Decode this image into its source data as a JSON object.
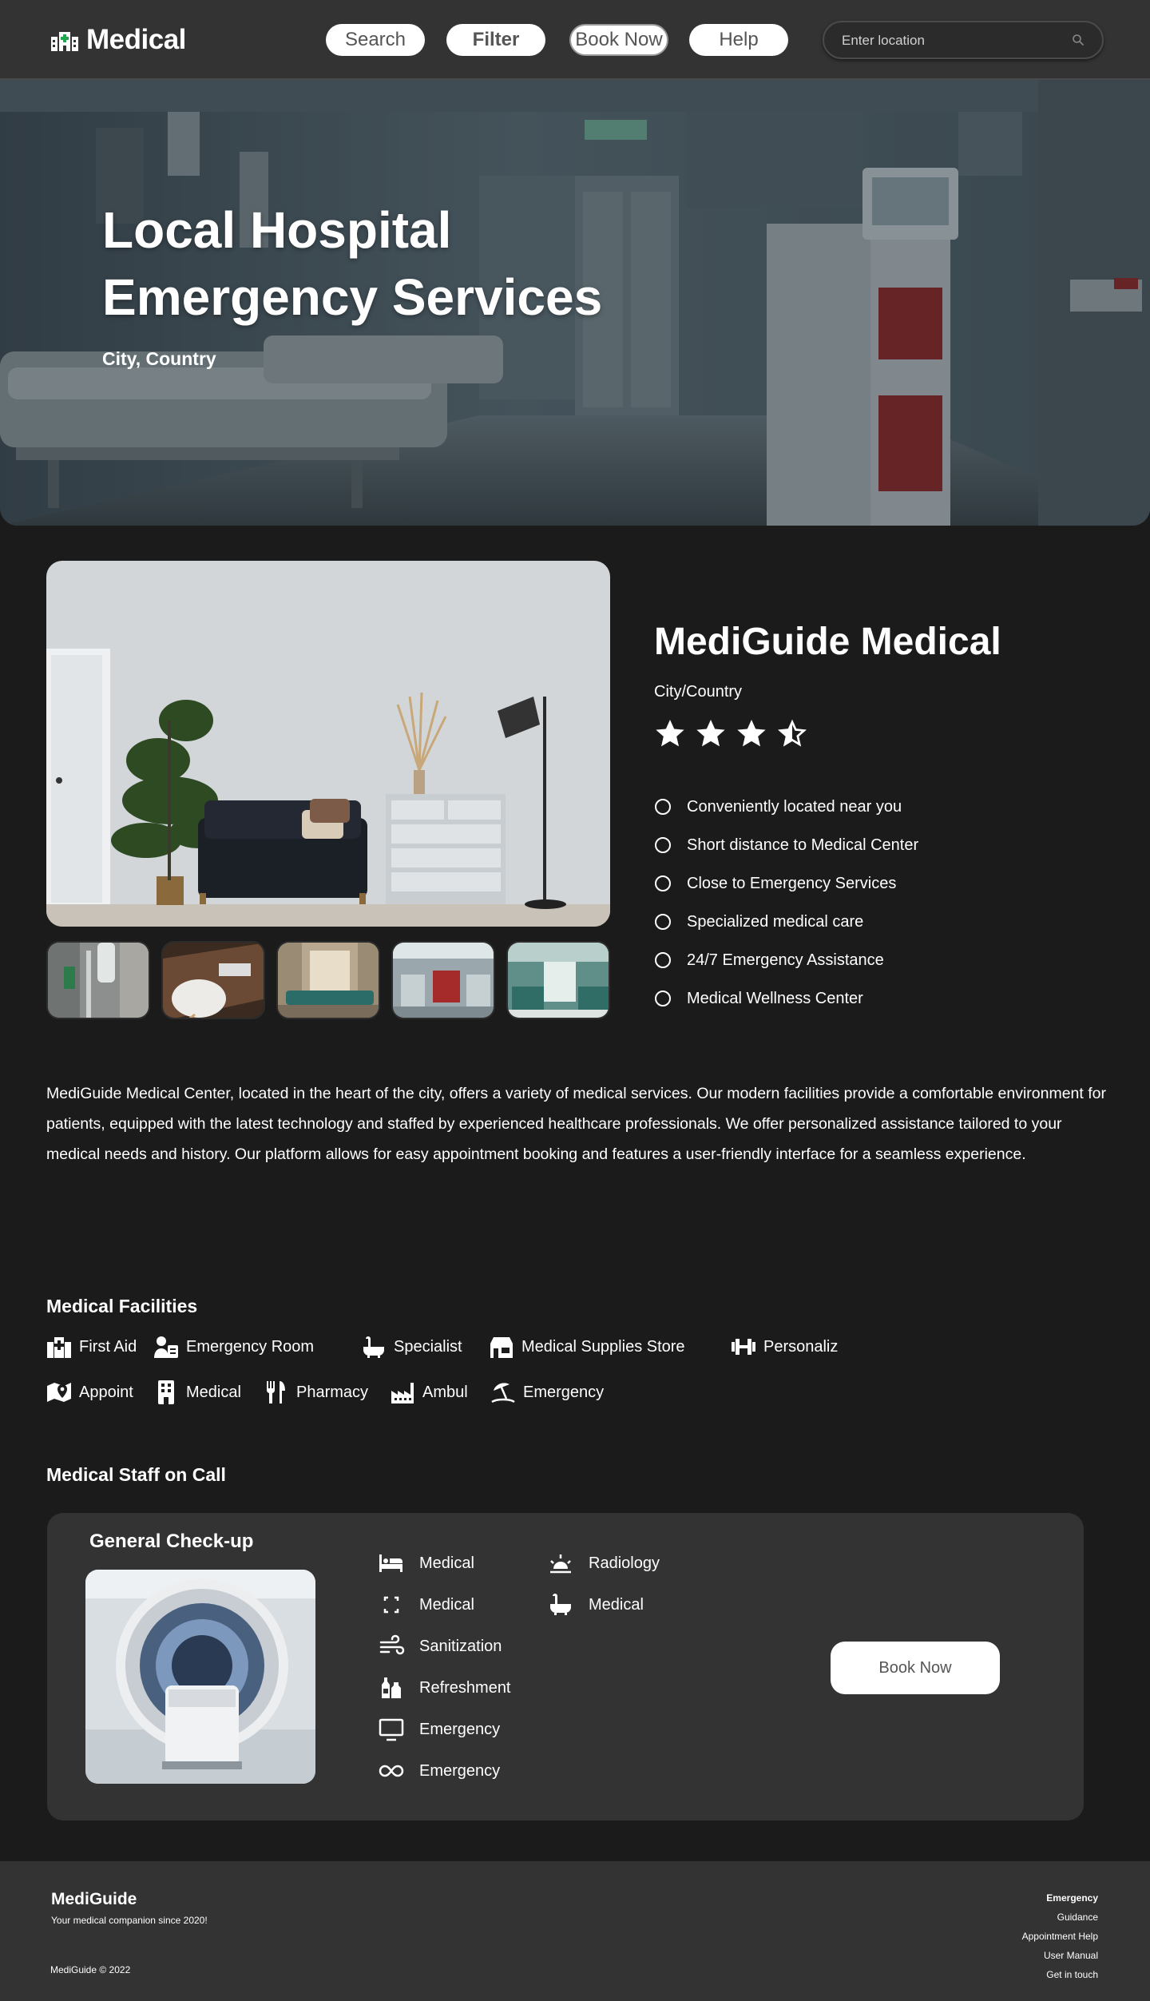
{
  "nav": {
    "brand": "Medical",
    "buttons": [
      "Search",
      "Filter",
      "Book Now",
      "Help"
    ],
    "location_placeholder": "Enter location"
  },
  "hero": {
    "title": "Local Hospital Emergency Services",
    "subtitle": "City, Country"
  },
  "clinic": {
    "name": "MediGuide Medical",
    "location": "City/Country",
    "rating": 3.5,
    "rating_max": 4,
    "features": [
      "Conveniently located near you",
      "Short distance to Medical Center",
      "Close to Emergency Services",
      "Specialized medical care",
      "24/7 Emergency Assistance",
      "Medical Wellness Center"
    ],
    "description": "MediGuide Medical Center, located in the heart of the city, offers a variety of medical services. Our modern facilities provide a comfortable environment for patients, equipped with the latest technology and staffed by experienced healthcare professionals. We offer personalized assistance tailored to your medical needs and history. Our platform allows for easy appointment booking and features a user-friendly interface for a seamless experience."
  },
  "facilities": {
    "title": "Medical Facilities",
    "items": [
      {
        "label": "First Aid",
        "icon": "hospital-building-icon"
      },
      {
        "label": "Emergency Room",
        "icon": "doctor-id-icon"
      },
      {
        "label": "Specialist",
        "icon": "bathtub-icon"
      },
      {
        "label": "Medical Supplies Store",
        "icon": "shop-icon"
      },
      {
        "label": "Personaliz",
        "icon": "dumbbell-icon"
      },
      {
        "label": "Appoint",
        "icon": "map-pin-icon"
      },
      {
        "label": "Medical",
        "icon": "building-icon"
      },
      {
        "label": "Pharmacy",
        "icon": "utensils-icon"
      },
      {
        "label": "Ambul",
        "icon": "factory-icon"
      },
      {
        "label": "Emergency",
        "icon": "beach-umbrella-icon"
      }
    ]
  },
  "staff": {
    "title": "Medical Staff on Call",
    "card": {
      "title": "General Check-up",
      "services_col1": [
        {
          "label": "Medical",
          "icon": "bed-icon"
        },
        {
          "label": "Medical",
          "icon": "expand-icon"
        },
        {
          "label": "Sanitization",
          "icon": "wind-icon"
        },
        {
          "label": "Refreshment",
          "icon": "bottles-icon"
        },
        {
          "label": "Emergency",
          "icon": "monitor-icon"
        },
        {
          "label": "Emergency",
          "icon": "infinity-icon"
        }
      ],
      "services_col2": [
        {
          "label": "Radiology",
          "icon": "sunrise-icon"
        },
        {
          "label": "Medical",
          "icon": "bathtub-icon"
        }
      ],
      "book_label": "Book Now"
    }
  },
  "footer": {
    "brand": "MediGuide",
    "tagline": "Your medical companion since 2020!",
    "copyright": "MediGuide © 2022",
    "links": [
      "Emergency",
      "Guidance",
      "Appointment Help",
      "User Manual",
      "Get in touch"
    ]
  },
  "colors": {
    "background": "#1b1b1b",
    "panel": "#333333",
    "accent_red": "#8f2424",
    "text": "#ffffff"
  }
}
